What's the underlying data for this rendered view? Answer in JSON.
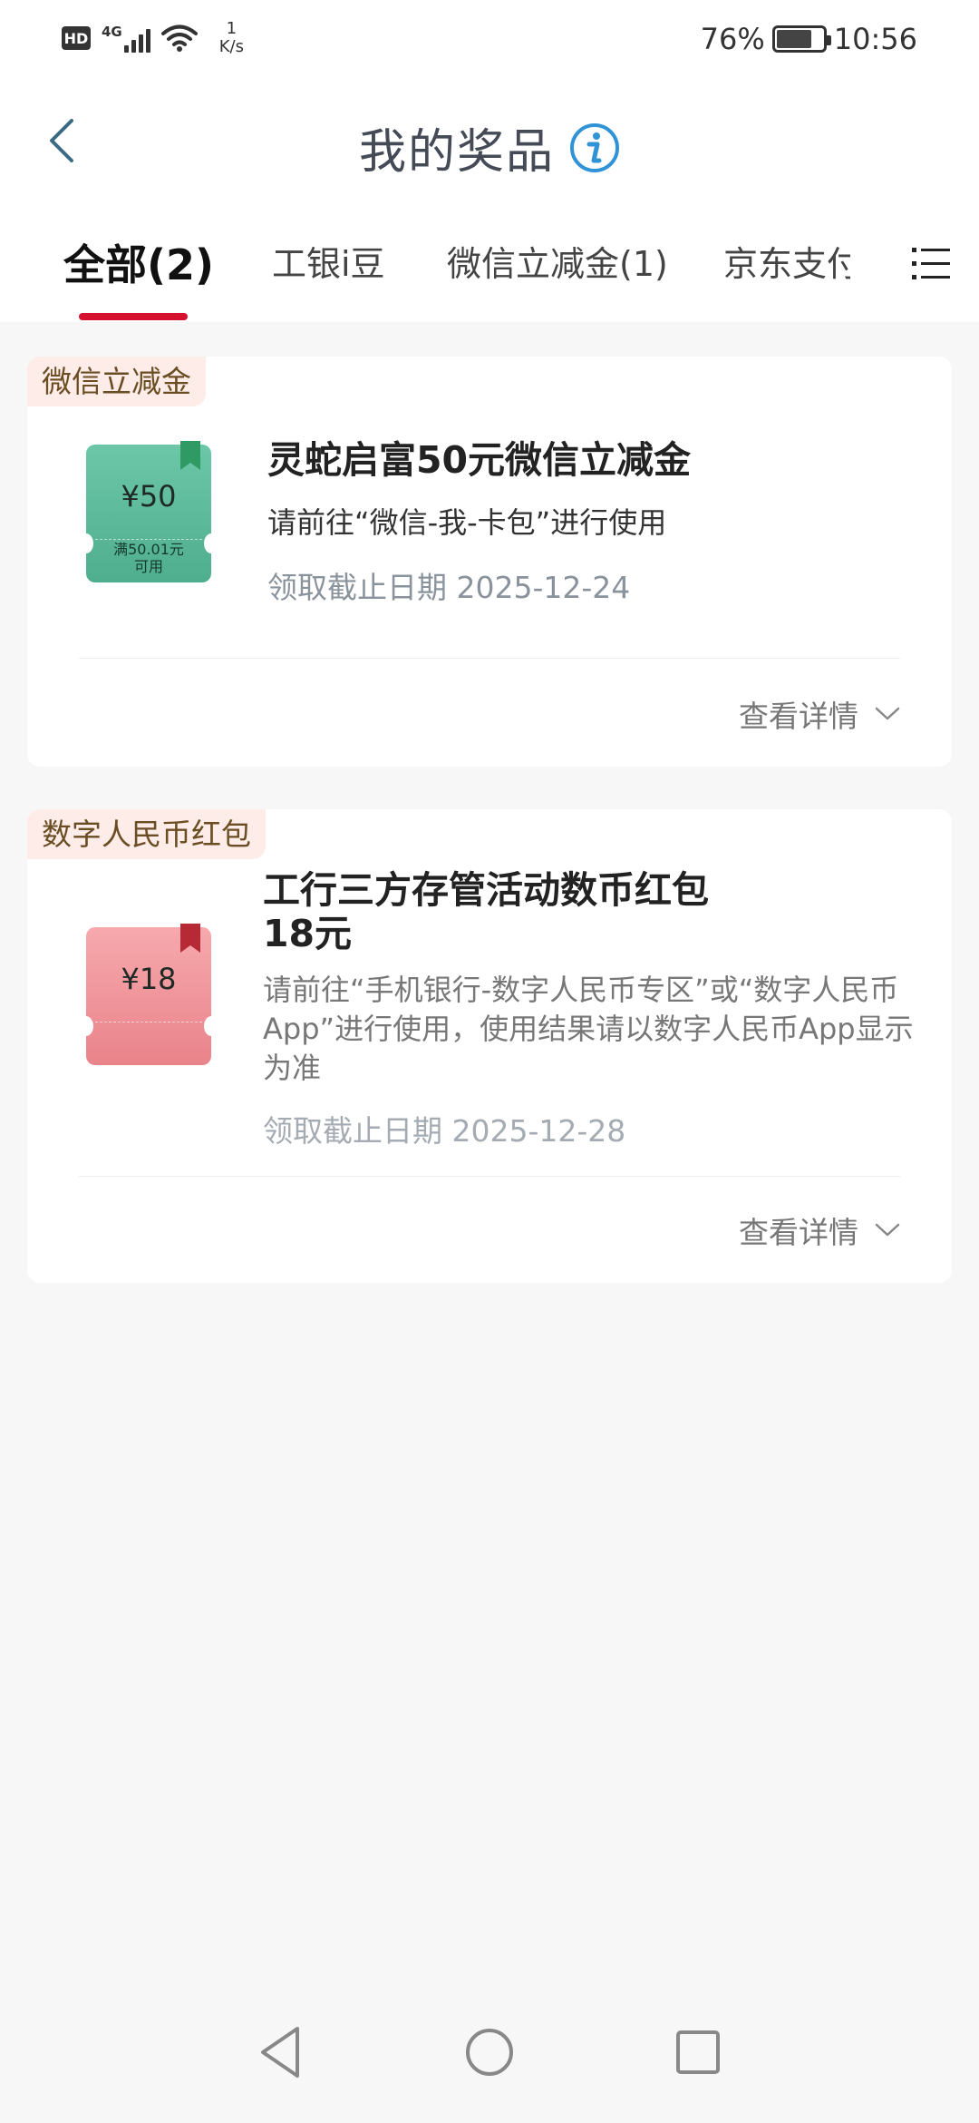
{
  "status_bar": {
    "hd": "HD",
    "network": "4G",
    "speed_value": "1",
    "speed_unit": "K/s",
    "battery_percent": "76%",
    "battery_level": 0.76,
    "time": "10:56"
  },
  "header": {
    "title": "我的奖品",
    "back_icon": "chevron-left-icon",
    "info_icon": "info-icon"
  },
  "tabs": [
    {
      "label": "全部(2)",
      "active": true
    },
    {
      "label": "工银i豆",
      "active": false
    },
    {
      "label": "微信立减金(1)",
      "active": false
    },
    {
      "label": "京东支付",
      "active": false
    }
  ],
  "colors": {
    "accent_red": "#d6112e",
    "tag_bg": "#fdece8",
    "tag_text": "#6a4d23",
    "green_coupon": "#5fbb9b",
    "pink_coupon": "#ee8c92"
  },
  "prizes": [
    {
      "tag": "微信立减金",
      "coupon_amount": "¥50",
      "coupon_condition_1": "满50.01元",
      "coupon_condition_2": "可用",
      "title": "灵蛇启富50元微信立减金",
      "description": "请前往“微信-我-卡包”进行使用",
      "deadline": "领取截止日期 2025-12-24",
      "detail_label": "查看详情"
    },
    {
      "tag": "数字人民币红包",
      "coupon_amount": "¥18",
      "title": "工行三方存管活动数币红包18元",
      "description": "请前往“手机银行-数字人民币专区”或“数字人民币App”进行使用，使用结果请以数字人民币App显示为准",
      "deadline": "领取截止日期 2025-12-28",
      "detail_label": "查看详情"
    }
  ]
}
